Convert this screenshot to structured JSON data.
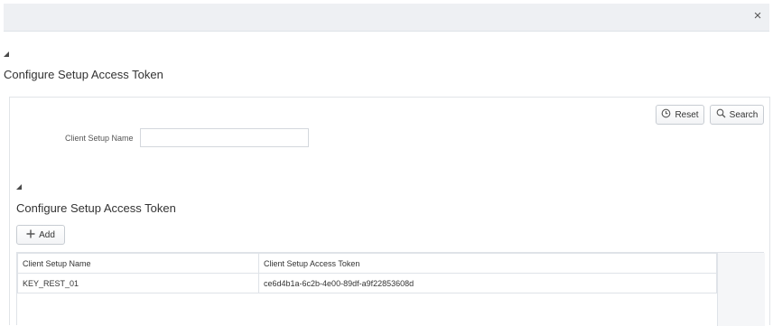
{
  "window": {
    "close_glyph": "×"
  },
  "page": {
    "title": "Configure Setup Access Token"
  },
  "search": {
    "reset_label": "Reset",
    "search_label": "Search",
    "client_setup_name_label": "Client Setup Name",
    "client_setup_name_value": "",
    "client_setup_name_placeholder": ""
  },
  "results": {
    "title": "Configure Setup Access Token",
    "add_label": "Add",
    "columns": [
      "Client Setup Name",
      "Client Setup Access Token"
    ],
    "rows": [
      [
        "KEY_REST_01",
        "ce6d4b1a-6c2b-4e00-89df-a9f22853608d"
      ]
    ]
  },
  "icons": {
    "close": "close-icon",
    "reset": "clock-reset-icon",
    "search": "magnifier-icon",
    "add": "plus-icon",
    "collapse": "collapse-triangle-icon"
  },
  "colors": {
    "topbar_bg": "#eef0f3",
    "border": "#dfe3e8",
    "text": "#333333"
  }
}
